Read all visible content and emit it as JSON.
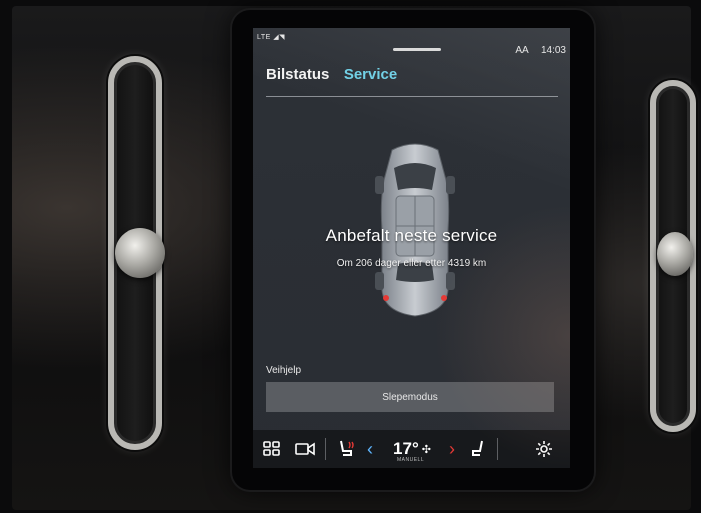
{
  "status_bar": {
    "left_text": "LTE",
    "text_size_indicator": "AA",
    "time": "14:03"
  },
  "tabs": [
    {
      "label": "Bilstatus",
      "active": false
    },
    {
      "label": "Service",
      "active": true
    }
  ],
  "service": {
    "title": "Anbefalt neste service",
    "detail": "Om 206 dager eller etter 4319 km"
  },
  "roadside": {
    "section_label": "Veihjelp",
    "button_label": "Slepemodus"
  },
  "climate_bar": {
    "temperature": "17°",
    "mode": "MANUELL",
    "icons": [
      "apps-grid-icon",
      "video-camera-icon",
      "seat-heat-driver-icon",
      "chevron-left-icon",
      "fan-icon",
      "chevron-right-icon",
      "seat-heat-passenger-icon",
      "gear-icon"
    ]
  },
  "colors": {
    "accent": "#6fd0e6",
    "screen_bg": "#2b2f35",
    "climate_bar_bg": "#17191c",
    "warning_red": "#e53935",
    "button_bg": "#5a5d62"
  }
}
